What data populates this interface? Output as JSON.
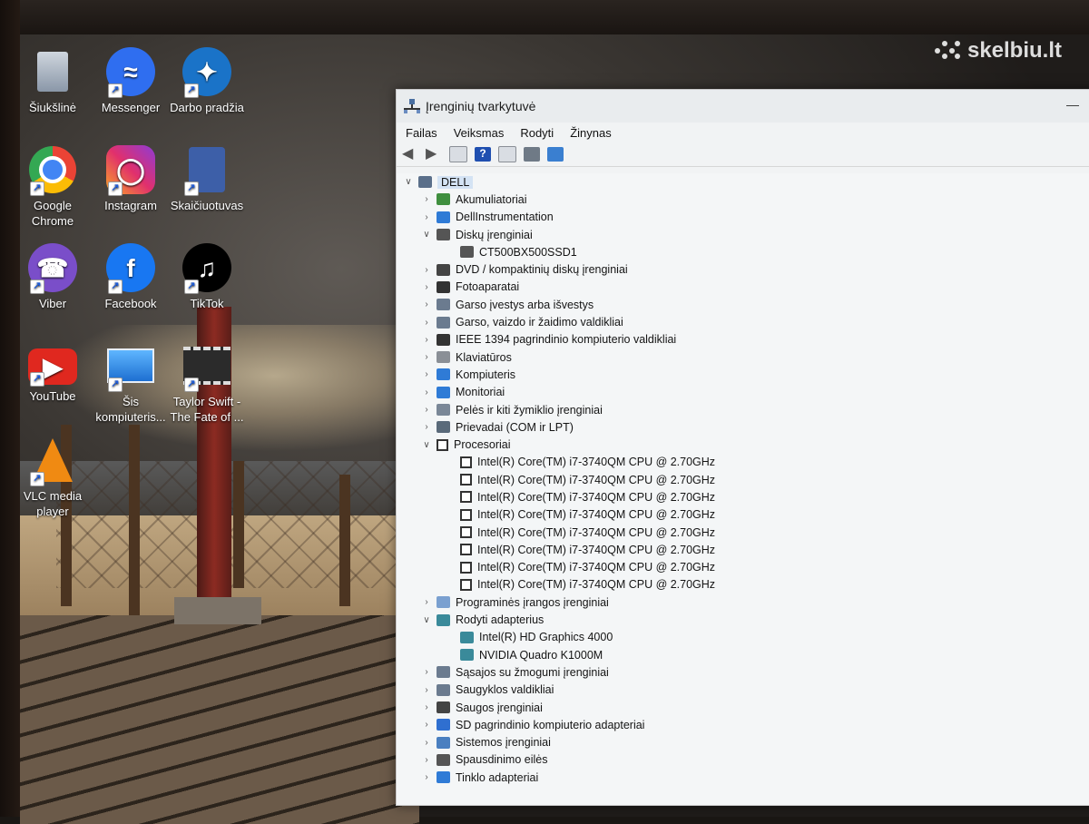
{
  "watermark": {
    "text": "skelbiu.lt"
  },
  "desktop_icons": [
    {
      "label": "Šiukšlinė",
      "icon": "recycle-bin-icon"
    },
    {
      "label": "Messenger",
      "icon": "messenger-icon",
      "color": "#2f6ef0"
    },
    {
      "label": "Darbo pradžia",
      "icon": "get-started-icon",
      "color": "#1a73c8"
    },
    {
      "label": "Google Chrome",
      "icon": "chrome-icon"
    },
    {
      "label": "Instagram",
      "icon": "instagram-icon",
      "color": "#d6297a"
    },
    {
      "label": "Skaičiuotuvas",
      "icon": "calculator-icon",
      "color": "#3d5fa8"
    },
    {
      "label": "Viber",
      "icon": "viber-icon",
      "color": "#7a4ec9"
    },
    {
      "label": "Facebook",
      "icon": "facebook-icon",
      "color": "#1877f2"
    },
    {
      "label": "TikTok",
      "icon": "tiktok-icon",
      "color": "#000000"
    },
    {
      "label": "YouTube",
      "icon": "youtube-icon",
      "color": "#e0281f"
    },
    {
      "label": "Šis kompiuteris...",
      "icon": "this-pc-icon",
      "color": "#2a8fe0"
    },
    {
      "label": "Taylor Swift - The Fate of ...",
      "icon": "video-file-icon"
    },
    {
      "label": "VLC media player",
      "icon": "vlc-icon",
      "color": "#f08a12"
    }
  ],
  "window": {
    "title": "Įrenginių tvarkytuvė",
    "menu": [
      "Failas",
      "Veiksmas",
      "Rodyti",
      "Žinynas"
    ],
    "toolbar_icons": [
      "back-icon",
      "forward-icon",
      "properties-icon",
      "help-icon",
      "details-icon",
      "scan-icon",
      "monitor-icon"
    ]
  },
  "tree": {
    "root": "DELL",
    "items": [
      {
        "label": "Akumuliatoriai",
        "icon": "battery-icon",
        "expanded": false,
        "children": []
      },
      {
        "label": "DellInstrumentation",
        "icon": "monitor-icon",
        "expanded": false,
        "children": []
      },
      {
        "label": "Diskų įrenginiai",
        "icon": "disk-icon",
        "expanded": true,
        "children": [
          "CT500BX500SSD1"
        ]
      },
      {
        "label": "DVD / kompaktinių diskų įrenginiai",
        "icon": "dvd-icon",
        "expanded": false,
        "children": []
      },
      {
        "label": "Fotoaparatai",
        "icon": "camera-icon",
        "expanded": false,
        "children": []
      },
      {
        "label": "Garso įvestys arba išvestys",
        "icon": "speaker-icon",
        "expanded": false,
        "children": []
      },
      {
        "label": "Garso, vaizdo ir žaidimo valdikliai",
        "icon": "speaker-icon",
        "expanded": false,
        "children": []
      },
      {
        "label": "IEEE 1394 pagrindinio kompiuterio valdikliai",
        "icon": "plug-icon",
        "expanded": false,
        "children": []
      },
      {
        "label": "Klaviatūros",
        "icon": "keyboard-icon",
        "expanded": false,
        "children": []
      },
      {
        "label": "Kompiuteris",
        "icon": "computer-icon",
        "expanded": false,
        "children": []
      },
      {
        "label": "Monitoriai",
        "icon": "monitor-icon",
        "expanded": false,
        "children": []
      },
      {
        "label": "Pelės ir kiti žymiklio įrenginiai",
        "icon": "mouse-icon",
        "expanded": false,
        "children": []
      },
      {
        "label": "Prievadai (COM ir LPT)",
        "icon": "port-icon",
        "expanded": false,
        "children": []
      },
      {
        "label": "Procesoriai",
        "icon": "cpu-icon",
        "expanded": true,
        "children": [
          "Intel(R) Core(TM) i7-3740QM CPU @ 2.70GHz",
          "Intel(R) Core(TM) i7-3740QM CPU @ 2.70GHz",
          "Intel(R) Core(TM) i7-3740QM CPU @ 2.70GHz",
          "Intel(R) Core(TM) i7-3740QM CPU @ 2.70GHz",
          "Intel(R) Core(TM) i7-3740QM CPU @ 2.70GHz",
          "Intel(R) Core(TM) i7-3740QM CPU @ 2.70GHz",
          "Intel(R) Core(TM) i7-3740QM CPU @ 2.70GHz",
          "Intel(R) Core(TM) i7-3740QM CPU @ 2.70GHz"
        ]
      },
      {
        "label": "Programinės įrangos įrenginiai",
        "icon": "software-device-icon",
        "expanded": false,
        "children": []
      },
      {
        "label": "Rodyti adapterius",
        "icon": "display-adapter-icon",
        "expanded": true,
        "children": [
          "Intel(R) HD Graphics 4000",
          "NVIDIA Quadro K1000M"
        ]
      },
      {
        "label": "Sąsajos su žmogumi įrenginiai",
        "icon": "hid-icon",
        "expanded": false,
        "children": []
      },
      {
        "label": "Saugyklos valdikliai",
        "icon": "storage-controller-icon",
        "expanded": false,
        "children": []
      },
      {
        "label": "Saugos įrenginiai",
        "icon": "security-device-icon",
        "expanded": false,
        "children": []
      },
      {
        "label": "SD pagrindinio kompiuterio adapteriai",
        "icon": "sd-card-icon",
        "expanded": false,
        "children": []
      },
      {
        "label": "Sistemos įrenginiai",
        "icon": "system-device-icon",
        "expanded": false,
        "children": []
      },
      {
        "label": "Spausdinimo eilės",
        "icon": "printer-icon",
        "expanded": false,
        "children": []
      },
      {
        "label": "Tinklo adapteriai",
        "icon": "network-icon",
        "expanded": false,
        "children": []
      }
    ]
  }
}
